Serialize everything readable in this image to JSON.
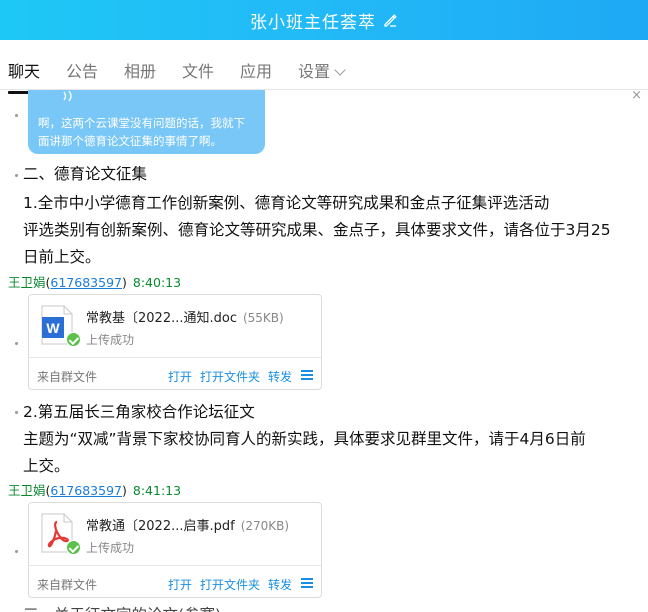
{
  "header": {
    "title": "张小班主任荟萃"
  },
  "tabs": [
    {
      "label": "聊天",
      "active": true
    },
    {
      "label": "公告"
    },
    {
      "label": "相册"
    },
    {
      "label": "文件"
    },
    {
      "label": "应用"
    },
    {
      "label": "设置"
    }
  ],
  "close_glyph": "×",
  "bubble": {
    "text_line1": "啊，这两个云课堂没有问题的话，我就下",
    "text_line2": "面讲那个德育论文征集的事情了啊。"
  },
  "section2": {
    "heading": "二、德育论文征集",
    "item1_title": "1.全市中小学德育工作创新案例、德育论文等研究成果和金点子征集评选活动",
    "item1_line1": "评选类别有创新案例、德育论文等研究成果、金点子，具体要求文件，请各位于3月25",
    "item1_line2": "日前上交。",
    "item2_title": "2.第五届长三角家校合作论坛征文",
    "item2_line1": "主题为“双减”背景下家校协同育人的新实践，具体要求见群里文件，请于4月6日前",
    "item2_line2": "上交。",
    "cut_line": "三、关于征文字的论文(参赛)"
  },
  "messages": [
    {
      "sender_name": "王卫娟",
      "sender_qq": "617683597",
      "time": "8:40:13",
      "file": {
        "name": "常教基〔2022...通知.doc",
        "size": "(55KB)",
        "status": "上传成功",
        "source": "来自群文件",
        "actions": [
          "打开",
          "打开文件夹",
          "转发"
        ],
        "icon": "word-doc-icon"
      }
    },
    {
      "sender_name": "王卫娟",
      "sender_qq": "617683597",
      "time": "8:41:13",
      "file": {
        "name": "常教通〔2022...启事.pdf",
        "size": "(270KB)",
        "status": "上传成功",
        "source": "来自群文件",
        "actions": [
          "打开",
          "打开文件夹",
          "转发"
        ],
        "icon": "pdf-icon"
      }
    }
  ],
  "colors": {
    "header_gradient_start": "#1ec8f6",
    "header_gradient_end": "#1ea9f4",
    "bubble": "#79c7f7",
    "sender": "#0a8a2e",
    "link": "#1a8fe0"
  }
}
